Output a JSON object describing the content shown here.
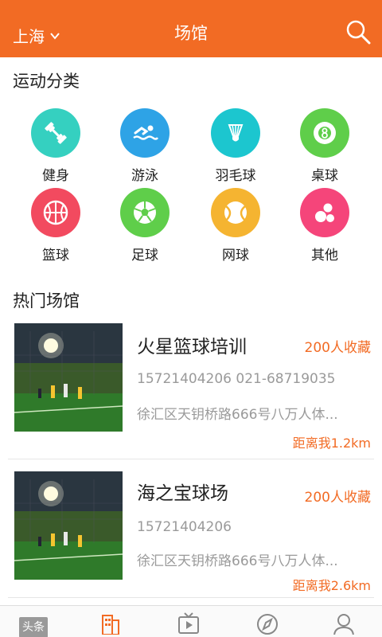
{
  "header": {
    "city": "上海",
    "title": "场馆"
  },
  "sports": {
    "title": "运动分类",
    "items": [
      {
        "label": "健身",
        "color": "#35d0c0",
        "icon": "dumbbell-icon"
      },
      {
        "label": "游泳",
        "color": "#2ea3e6",
        "icon": "swimmer-icon"
      },
      {
        "label": "羽毛球",
        "color": "#1cc6cf",
        "icon": "shuttlecock-icon"
      },
      {
        "label": "桌球",
        "color": "#5fce4a",
        "icon": "billiard-ball-icon"
      },
      {
        "label": "篮球",
        "color": "#f24a5f",
        "icon": "basketball-icon"
      },
      {
        "label": "足球",
        "color": "#5fce4a",
        "icon": "soccer-ball-icon"
      },
      {
        "label": "网球",
        "color": "#f5b431",
        "icon": "tennis-ball-icon"
      },
      {
        "label": "其他",
        "color": "#f5457a",
        "icon": "other-balls-icon"
      }
    ]
  },
  "hot": {
    "title": "热门场馆",
    "venues": [
      {
        "name": "火星篮球培训",
        "favorites": "200人收藏",
        "phone": "15721404206  021-68719035",
        "address": "徐汇区天钥桥路666号八万人体...",
        "distance": "距离我1.2km"
      },
      {
        "name": "海之宝球场",
        "favorites": "200人收藏",
        "phone": "15721404206",
        "address": "徐汇区天钥桥路666号八万人体...",
        "distance": "距离我2.6km"
      }
    ]
  },
  "tabbar": {
    "news_label": "头条",
    "active_color": "#f26b24",
    "tabs": [
      "news-tab",
      "venues-tab",
      "video-tab",
      "discover-tab",
      "profile-tab"
    ]
  }
}
